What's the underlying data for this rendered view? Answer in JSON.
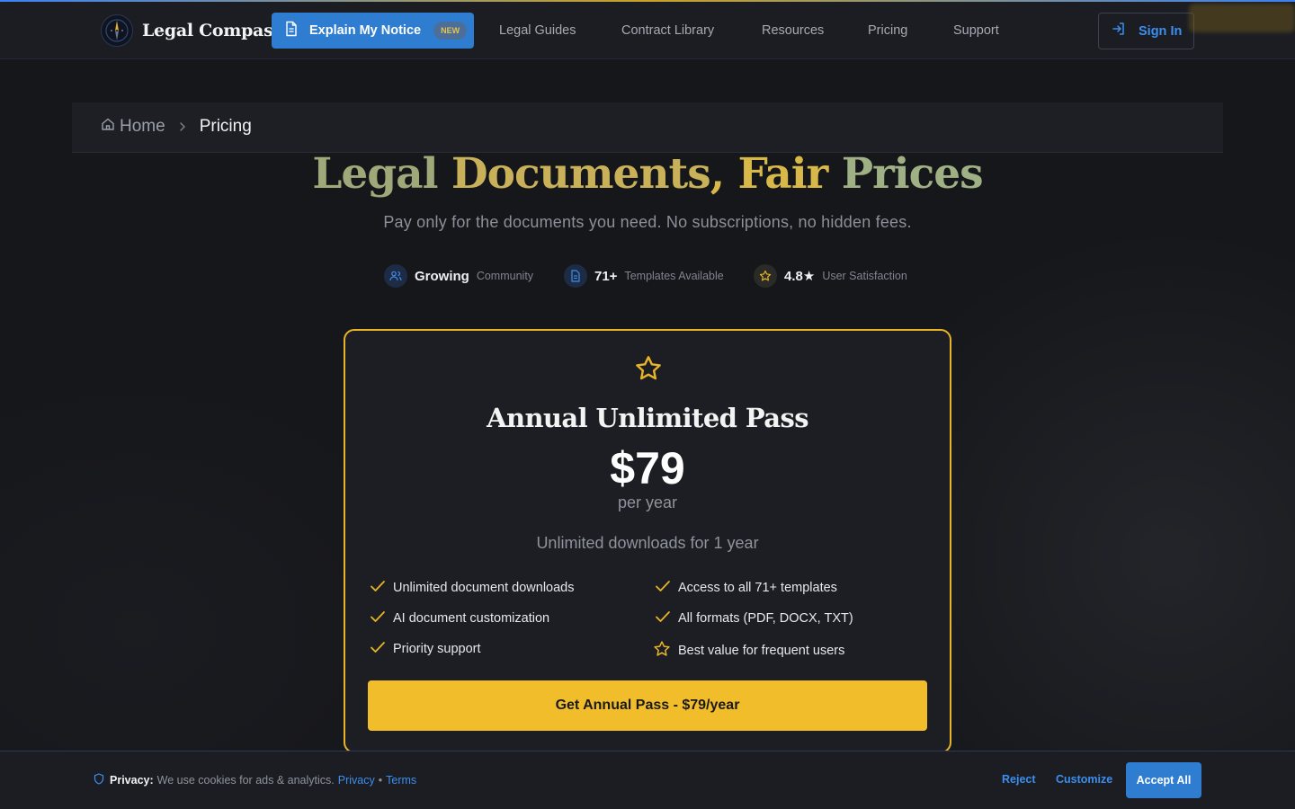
{
  "header": {
    "brand": "Legal Compass",
    "explain_button": "Explain My Notice",
    "explain_badge": "NEW",
    "nav": [
      {
        "label": "Legal Guides"
      },
      {
        "label": "Contract Library"
      },
      {
        "label": "Resources"
      },
      {
        "label": "Pricing"
      },
      {
        "label": "Support"
      }
    ],
    "sign_in": "Sign In"
  },
  "breadcrumb": {
    "home": "Home",
    "current": "Pricing"
  },
  "hero": {
    "title_parts": [
      "Legal ",
      "Documents",
      ", Fair ",
      "Prices"
    ],
    "subtitle": "Pay only for the documents you need. No subscriptions, no hidden fees.",
    "stats": [
      {
        "icon": "users-icon",
        "value": "Growing",
        "label": "Community"
      },
      {
        "icon": "document-icon",
        "value": "71+",
        "label": "Templates Available"
      },
      {
        "icon": "star-icon",
        "value": "4.8★",
        "label": "User Satisfaction"
      }
    ]
  },
  "plan": {
    "title": "Annual Unlimited Pass",
    "price": "$79",
    "period": "per year",
    "description": "Unlimited downloads for 1 year",
    "features": [
      {
        "icon": "check-icon",
        "text": "Unlimited document downloads"
      },
      {
        "icon": "check-icon",
        "text": "Access to all 71+ templates"
      },
      {
        "icon": "check-icon",
        "text": "AI document customization"
      },
      {
        "icon": "check-icon",
        "text": "All formats (PDF, DOCX, TXT)"
      },
      {
        "icon": "check-icon",
        "text": "Priority support"
      },
      {
        "icon": "star-icon",
        "text": "Best value for frequent users"
      }
    ],
    "cta": "Get Annual Pass - $79/year"
  },
  "cookie": {
    "label": "Privacy:",
    "text": "We use cookies for ads & analytics.",
    "privacy_link": "Privacy",
    "separator": "•",
    "terms_link": "Terms",
    "reject": "Reject",
    "customize": "Customize",
    "accept": "Accept All"
  },
  "colors": {
    "accent_blue": "#2f7dd1",
    "gold": "#f1bd2a",
    "background": "#16171b"
  }
}
